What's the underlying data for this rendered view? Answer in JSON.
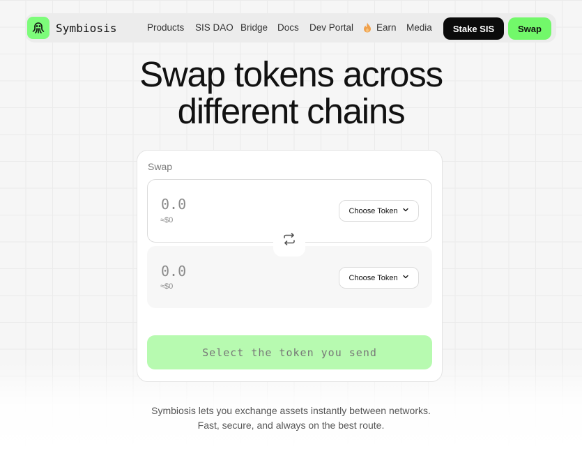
{
  "nav": {
    "brand": "Symbiosis",
    "links": [
      "Products",
      "SIS DAO",
      "Bridge",
      "Docs",
      "Dev Portal",
      "Earn",
      "Media"
    ],
    "stake_label": "Stake SIS",
    "swap_label": "Swap"
  },
  "hero": {
    "line1": "Swap tokens across",
    "line2": "different chains"
  },
  "card": {
    "title": "Swap",
    "from": {
      "amount": "0.0",
      "usd": "≈$0",
      "token_label": "Choose Token"
    },
    "to": {
      "amount": "0.0",
      "usd": "≈$0",
      "token_label": "Choose Token"
    },
    "action_label": "Select the token you send"
  },
  "description": {
    "line1": "Symbiosis lets you exchange assets instantly between networks.",
    "line2": "Fast, secure, and always on the best route."
  },
  "colors": {
    "accent": "#72f86a",
    "action_disabled": "#b7fab0",
    "dark_button": "#0b0b0b"
  },
  "icons": {
    "logo": "octopus-logo-icon",
    "earn": "flame-icon",
    "dropdown": "chevron-down-icon",
    "switch": "swap-arrows-icon"
  }
}
